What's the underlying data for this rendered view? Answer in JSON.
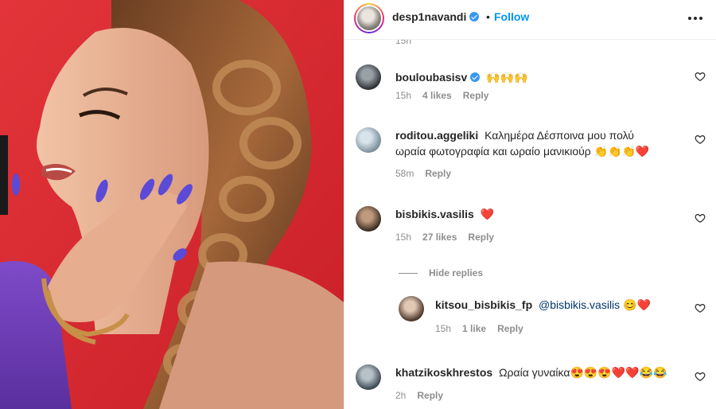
{
  "header": {
    "username": "desp1navandi",
    "verified": true,
    "separator": "•",
    "follow_label": "Follow",
    "more_icon": "more-horizontal-icon"
  },
  "cut_off_time": "15h",
  "comments": [
    {
      "username": "bouloubasisv",
      "verified": true,
      "text": "🙌🙌🙌",
      "time": "15h",
      "likes": "4 likes",
      "reply": "Reply"
    },
    {
      "username": "roditou.aggeliki",
      "verified": false,
      "text": "Καλημέρα Δέσποινα μου πολύ ωραία φωτογραφία και ωραίο μανικιούρ 👏👏👏❤️",
      "time": "58m",
      "likes": "",
      "reply": "Reply"
    },
    {
      "username": "bisbikis.vasilis",
      "verified": false,
      "text": "❤️",
      "time": "15h",
      "likes": "27 likes",
      "reply": "Reply"
    },
    {
      "username": "kitsou_bisbikis_fp",
      "verified": false,
      "mention": "@bisbikis.vasilis",
      "text": "😊❤️",
      "time": "15h",
      "likes": "1 like",
      "reply": "Reply"
    },
    {
      "username": "khatzikoskhrestos",
      "verified": false,
      "text": "Ωραία γυναίκα😍😍😍❤️❤️😂😂",
      "time": "2h",
      "likes": "",
      "reply": "Reply"
    }
  ],
  "hide_replies_label": "Hide replies",
  "colors": {
    "accent": "#0095f6",
    "photo_background": "#d92a2f",
    "nail_polish": "#5b4ad6",
    "muted_text": "#8e8e8e"
  }
}
